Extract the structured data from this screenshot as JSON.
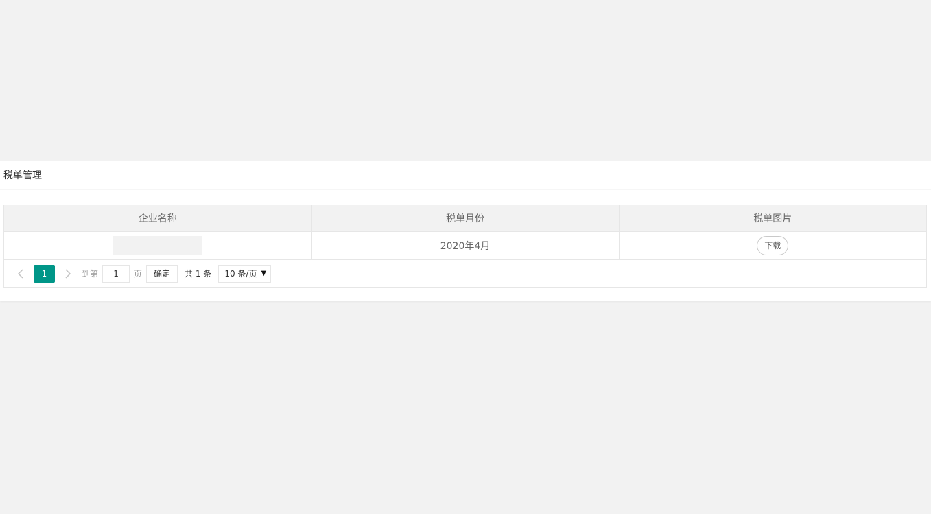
{
  "card": {
    "title": "税单管理"
  },
  "table": {
    "columns": [
      "企业名称",
      "税单月份",
      "税单图片"
    ],
    "rows": [
      {
        "company": "",
        "month": "2020年4月",
        "action_label": "下载"
      }
    ]
  },
  "pager": {
    "prev_icon": "chevron-left-icon",
    "next_icon": "chevron-right-icon",
    "current_page": "1",
    "goto_label": "到第",
    "jump_value": "1",
    "page_unit": "页",
    "confirm_label": "确定",
    "total_label": "共 1 条",
    "page_size_label": "10 条/页"
  },
  "colors": {
    "accent": "#009688",
    "background": "#f2f2f2",
    "border": "#e6e6e6"
  }
}
